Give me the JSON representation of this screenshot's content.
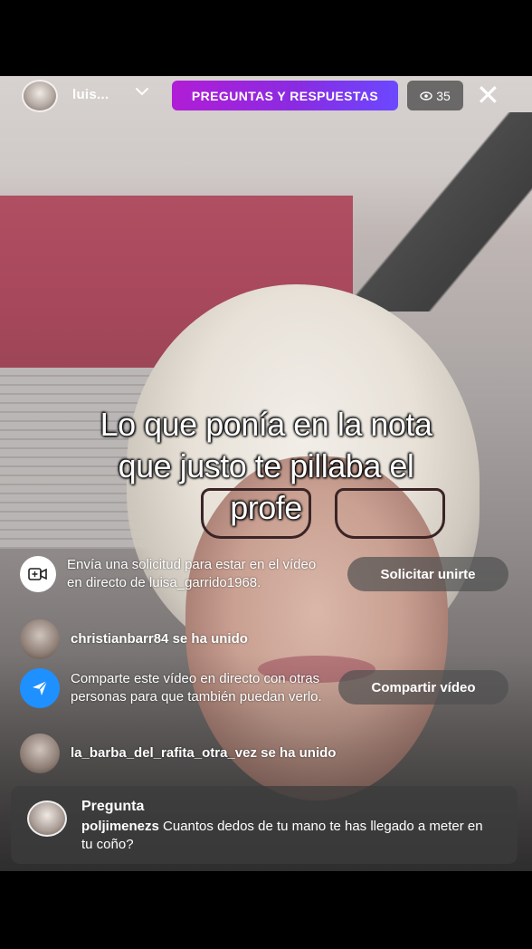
{
  "top_bar": {
    "username": "luis...",
    "qa_badge": "PREGUNTAS Y RESPUESTAS",
    "viewer_count": "35",
    "close_symbol": "✕"
  },
  "caption": {
    "line1": "Lo que ponía en la nota",
    "line2": "que justo te pillaba el",
    "line3": "profe"
  },
  "comments": {
    "request": {
      "text": "Envía una solicitud para estar en el vídeo en directo de luisa_garrido1968.",
      "button": "Solicitar unirte",
      "icon": "video-camera-icon"
    },
    "join1": {
      "user": "christianbarr84",
      "text": "se ha unido"
    },
    "share": {
      "text": "Comparte este vídeo en directo con otras personas para que también puedan verlo.",
      "button": "Compartir vídeo",
      "icon": "paper-plane-icon"
    },
    "join2": {
      "user": "la_barba_del_rafita_otra_vez",
      "text": "se ha unido"
    }
  },
  "question": {
    "label": "Pregunta",
    "user": "poljimenezs",
    "text": "Cuantos dedos de tu mano te has llegado a meter en tu coño?"
  },
  "colors": {
    "qa_gradient_start": "#b11dd6",
    "qa_gradient_end": "#6b48ff",
    "share_icon": "#1e90ff"
  }
}
